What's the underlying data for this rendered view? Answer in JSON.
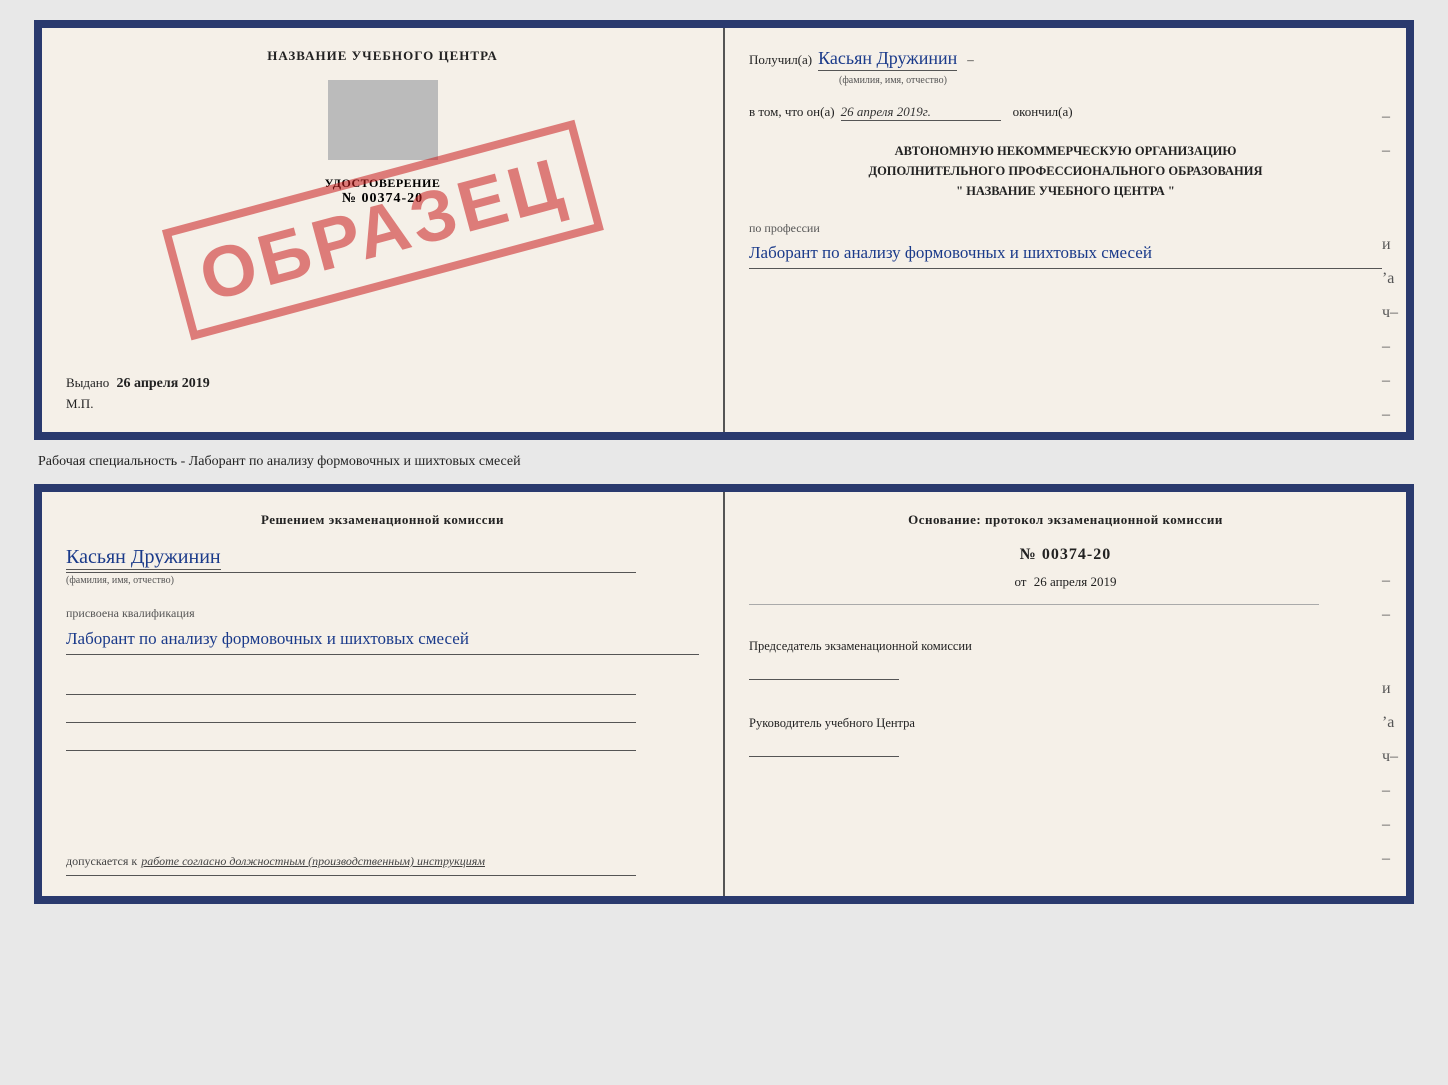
{
  "page": {
    "bg_color": "#e0e0e0"
  },
  "top_doc": {
    "left": {
      "title": "НАЗВАНИЕ УЧЕБНОГО ЦЕНТРА",
      "stamp": "ОБРАЗЕЦ",
      "udostoverenie_label": "УДОСТОВЕРЕНИЕ",
      "udostoverenie_number": "№ 00374-20",
      "vydano_label": "Выдано",
      "vydano_date": "26 апреля 2019",
      "mp_label": "М.П."
    },
    "right": {
      "poluchil_label": "Получил(a)",
      "poluchil_name": "Касьян Дружинин",
      "fio_hint": "(фамилия, имя, отчество)",
      "dash": "–",
      "vtom_label": "в том, что он(а)",
      "vtom_date": "26 апреля 2019г.",
      "okonchil_label": "окончил(а)",
      "org_line1": "АВТОНОМНУЮ НЕКОММЕРЧЕСКУЮ ОРГАНИЗАЦИЮ",
      "org_line2": "ДОПОЛНИТЕЛЬНОГО ПРОФЕССИОНАЛЬНОГО ОБРАЗОВАНИЯ",
      "org_line3": "\"  НАЗВАНИЕ УЧЕБНОГО ЦЕНТРА  \"",
      "po_professii_label": "по профессии",
      "professiya": "Лаборант по анализу формовочных и шихтовых смесей"
    }
  },
  "separator": {
    "text": "Рабочая специальность - Лаборант по анализу формовочных и шихтовых смесей"
  },
  "bottom_doc": {
    "left": {
      "resheniem_label": "Решением экзаменационной комиссии",
      "name": "Касьян Дружинин",
      "fio_hint": "(фамилия, имя, отчество)",
      "prisvoena_label": "присвоена квалификация",
      "kvalifikatsiya": "Лаборант по анализу формовочных и шихтовых смесей",
      "dopuskaetsya_label": "допускается к",
      "dopuskaetsya_text": "работе согласно должностным (производственным) инструкциям"
    },
    "right": {
      "osnovanie_label": "Основание: протокол экзаменационной комиссии",
      "number": "№ 00374-20",
      "ot_label": "от",
      "ot_date": "26 апреля 2019",
      "predsedatel_label": "Председатель экзаменационной комиссии",
      "rukovoditel_label": "Руководитель учебного Центра"
    }
  }
}
